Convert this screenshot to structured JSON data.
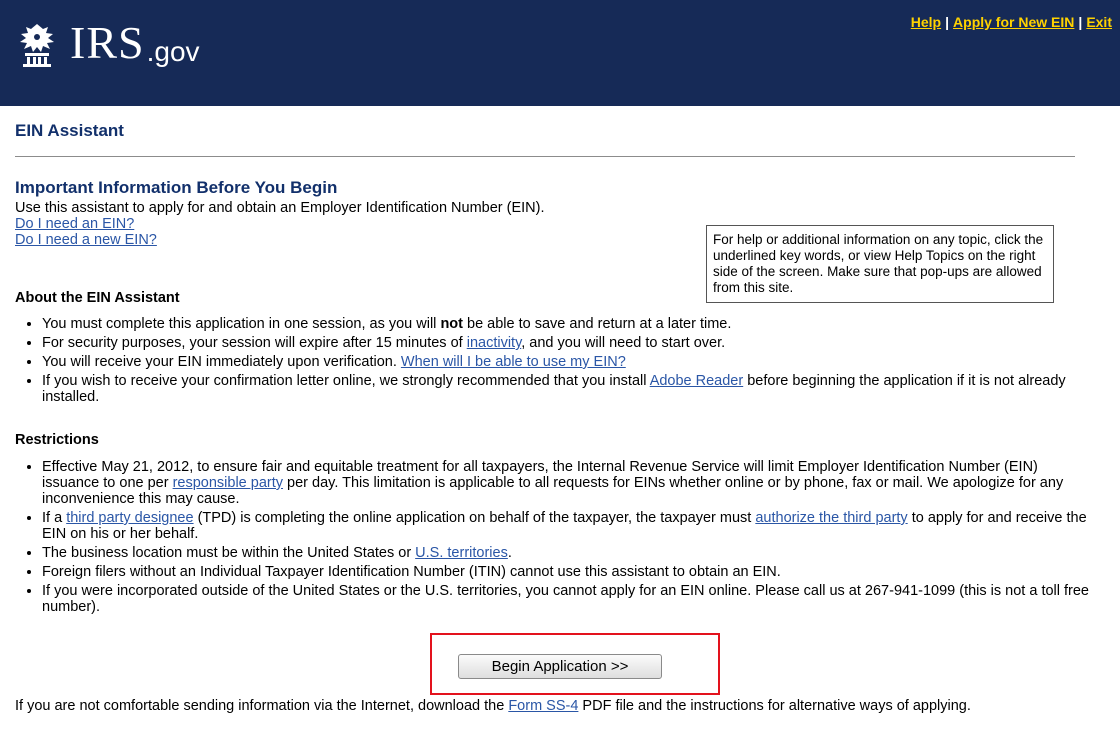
{
  "header": {
    "logo_main": "IRS",
    "logo_sub": ".gov",
    "links": [
      "Help",
      "Apply for New EIN",
      "Exit"
    ],
    "separator": "|"
  },
  "page_title": "EIN Assistant",
  "section_heading": "Important Information Before You Begin",
  "intro": {
    "text": "Use this assistant to apply for and obtain an Employer Identification Number (EIN).",
    "link_need_ein": "Do I need an EIN?",
    "link_need_new_ein": "Do I need a new EIN?"
  },
  "helpbox": {
    "text": "For help or additional information on any topic, click the underlined key words, or view Help Topics on the right side of the screen. Make sure that pop-ups are allowed from this site."
  },
  "about": {
    "heading": "About the EIN Assistant",
    "b1_pre": "You must complete this application in one session, as you will ",
    "b1_bold": "not",
    "b1_post": " be able to save and return at a later time.",
    "b2_pre": "For security purposes, your session will expire after 15 minutes of ",
    "b2_link": "inactivity",
    "b2_post": ", and you will need to start over.",
    "b3_pre": "You will receive your EIN immediately upon verification. ",
    "b3_link": "When will I be able to use my EIN?",
    "b4_pre": "If you wish to receive your confirmation letter online, we strongly recommended that you install ",
    "b4_link": "Adobe Reader",
    "b4_post": " before beginning the application if it is not already installed."
  },
  "restrictions": {
    "heading": "Restrictions",
    "r1_pre": "Effective May 21, 2012, to ensure fair and equitable treatment for all taxpayers, the Internal Revenue Service will limit Employer Identification Number (EIN) issuance to one per ",
    "r1_link": "responsible party",
    "r1_post": " per day. This limitation is applicable to all requests for EINs whether online or by phone, fax or mail.  We apologize for any inconvenience this may cause.",
    "r2_pre": "If a ",
    "r2_link1": "third party designee",
    "r2_mid": " (TPD) is completing the online application on behalf of the taxpayer, the taxpayer must ",
    "r2_link2": "authorize the third party",
    "r2_post": " to apply for and receive the EIN on his or her behalf.",
    "r3_pre": "The business location must be within the United States or ",
    "r3_link": "U.S. territories",
    "r3_post": ".",
    "r4": "Foreign filers without an Individual Taxpayer Identification Number (ITIN) cannot use this assistant to obtain an EIN.",
    "r5": "If you were incorporated outside of the United States or the U.S. territories, you cannot apply for an EIN online. Please call us at 267-941-1099 (this is not a toll free number)."
  },
  "begin_button": "Begin Application >>",
  "footer": {
    "pre": "If you are not comfortable sending information via the Internet, download the ",
    "link": "Form SS-4",
    "post": " PDF file and the instructions for alternative ways of applying."
  },
  "colors": {
    "header_bg": "#162a57",
    "header_link": "#ffd200",
    "heading": "#12306b",
    "link": "#2a56a6",
    "highlight_border": "#e3121d"
  },
  "icons": {
    "logo": "irs-eagle-logo-icon"
  }
}
